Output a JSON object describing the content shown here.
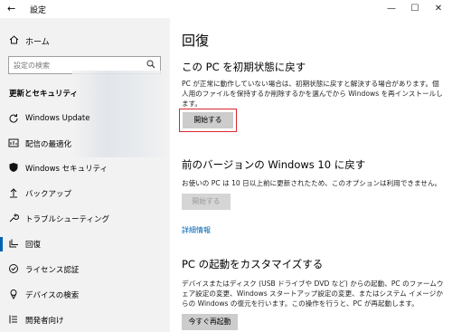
{
  "window": {
    "title": "設定",
    "back_glyph": "←",
    "min_glyph": "—",
    "max_glyph": "☐",
    "close_glyph": "✕"
  },
  "sidebar": {
    "home_label": "ホーム",
    "search_placeholder": "設定の検索",
    "section_title": "更新とセキュリティ",
    "items": [
      {
        "label": "Windows Update",
        "icon": "sync-icon"
      },
      {
        "label": "配信の最適化",
        "icon": "delivery-optimization-icon"
      },
      {
        "label": "Windows セキュリティ",
        "icon": "shield-icon"
      },
      {
        "label": "バックアップ",
        "icon": "backup-icon"
      },
      {
        "label": "トラブルシューティング",
        "icon": "wrench-icon"
      },
      {
        "label": "回復",
        "icon": "recovery-icon",
        "selected": true
      },
      {
        "label": "ライセンス認証",
        "icon": "activation-icon"
      },
      {
        "label": "デバイスの検索",
        "icon": "find-device-icon"
      },
      {
        "label": "開発者向け",
        "icon": "developer-icon"
      }
    ]
  },
  "main": {
    "title": "回復",
    "reset": {
      "heading": "この PC を初期状態に戻す",
      "desc": "PC が正常に動作していない場合は、初期状態に戻すと解決する場合があります。個人用のファイルを保持するか削除するかを選んでから Windows を再インストールします。",
      "button": "開始する"
    },
    "goback": {
      "heading": "前のバージョンの Windows 10 に戻す",
      "desc": "お使いの PC は 10 日以上前に更新されたため、このオプションは利用できません。",
      "button": "開始する",
      "link": "詳細情報"
    },
    "advanced": {
      "heading": "PC の起動をカスタマイズする",
      "desc": "デバイスまたはディスク (USB ドライブや DVD など) からの起動、PC のファームウェア設定の変更、Windows スタートアップ設定の変更、またはシステム イメージからの Windows の復元を行います。この操作を行うと、PC が再起動します。",
      "button": "今すぐ再起動"
    }
  },
  "colors": {
    "accent": "#0063b1",
    "highlight": "#d9282f",
    "sidebar_bg": "#f2f2f2"
  }
}
